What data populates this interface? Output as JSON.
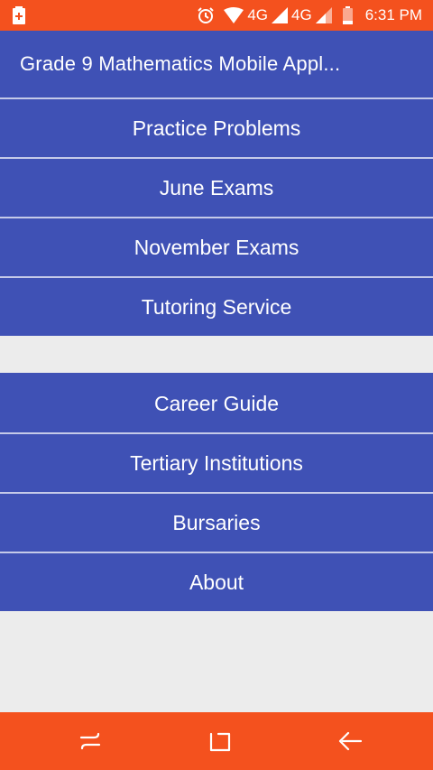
{
  "status_bar": {
    "network_1": "4G",
    "network_2": "4G",
    "time": "6:31 PM",
    "icons": [
      "battery-charging-icon",
      "alarm-icon",
      "wifi-icon",
      "signal-icon",
      "signal-icon",
      "battery-icon"
    ]
  },
  "app_bar": {
    "title": "Grade 9 Mathematics Mobile Appl..."
  },
  "menu": {
    "group_1": [
      {
        "label": "Practice Problems"
      },
      {
        "label": "June Exams"
      },
      {
        "label": "November Exams"
      },
      {
        "label": "Tutoring Service"
      }
    ],
    "group_2": [
      {
        "label": "Career Guide"
      },
      {
        "label": "Tertiary Institutions"
      },
      {
        "label": "Bursaries"
      },
      {
        "label": "About"
      }
    ]
  },
  "nav_bar": {
    "icons": [
      "recent-apps-icon",
      "home-icon",
      "back-icon"
    ]
  },
  "colors": {
    "status_bar": "#f4511e",
    "app_bar": "#3f51b5",
    "menu_item": "#3f51b5",
    "divider": "#c5cae9",
    "background": "#ececec"
  }
}
